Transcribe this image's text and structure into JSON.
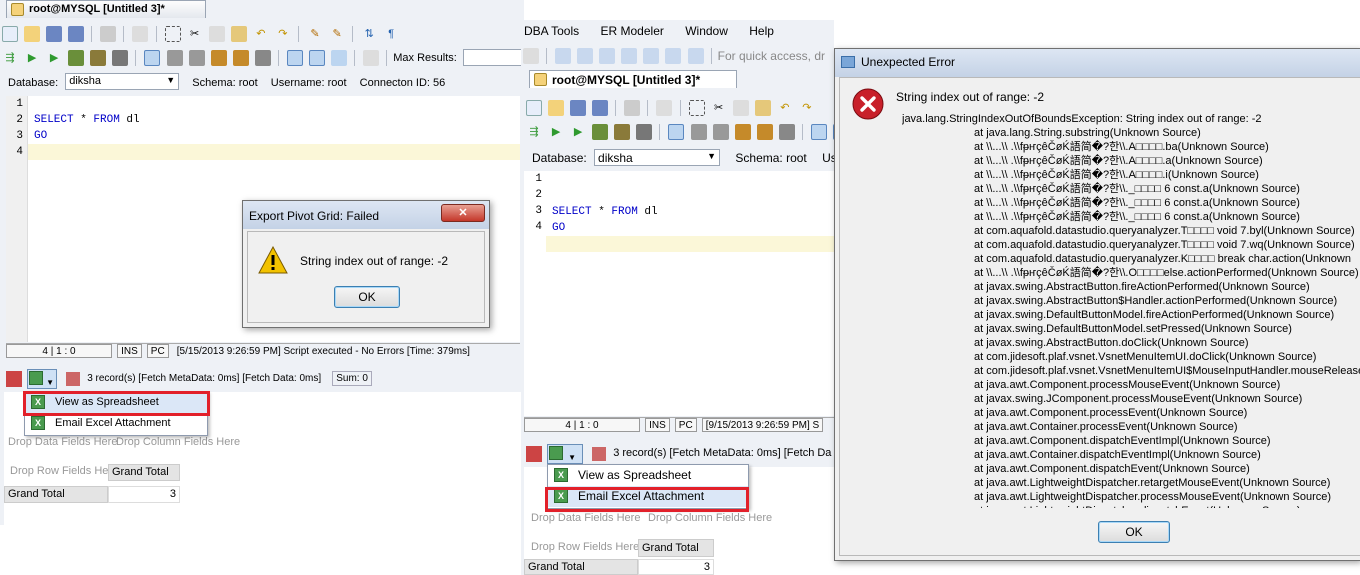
{
  "left_window": {
    "tab_title": "root@MYSQL [Untitled 3]*",
    "max_results_label": "Max Results:",
    "database_label": "Database:",
    "database_value": "diksha",
    "schema_text": "Schema:  root",
    "username_text": "Username:  root",
    "connection_text": "Connecton ID:  56",
    "line_numbers": [
      "1",
      "2",
      "3",
      "4"
    ],
    "code_kw_select": "SELECT",
    "code_star": " * ",
    "code_kw_from": "FROM",
    "code_table": " dl",
    "code_go": "GO",
    "status": {
      "pos": "4 | 1 : 0",
      "mode1": "INS",
      "mode2": "PC",
      "message": "[5/15/2013 9:26:59 PM] Script executed - No Errors [Time: 379ms]"
    },
    "results_bar": {
      "records": "3 record(s) [Fetch MetaData: 0ms] [Fetch Data: 0ms]",
      "sum": "Sum: 0"
    },
    "menu": {
      "item1": "View as Spreadsheet",
      "item2": "Email Excel Attachment"
    },
    "pivot": {
      "drop_data": "Drop Data Fields Here",
      "drop_column": "Drop Column Fields Here",
      "drop_row": "Drop Row Fields Here",
      "grand_total_header": "Grand Total",
      "grand_total_row": "Grand Total",
      "grand_total_value": "3"
    }
  },
  "export_dialog": {
    "title": "Export Pivot Grid: Failed",
    "message": "String index out of range: -2",
    "ok": "OK",
    "close": "✕"
  },
  "middle_window": {
    "menu_items": [
      "DBA Tools",
      "ER Modeler",
      "Window",
      "Help"
    ],
    "quick_access": "For quick access, dr",
    "tab_title": "root@MYSQL [Untitled 3]*",
    "database_label": "Database:",
    "database_value": "diksha",
    "schema_text": "Schema:  root",
    "user_text": "User",
    "line_numbers": [
      "1",
      "2",
      "3",
      "4"
    ],
    "code_kw_select": "SELECT",
    "code_star": " * ",
    "code_kw_from": "FROM",
    "code_table": " dl",
    "code_go": "GO",
    "status": {
      "pos": "4 | 1 : 0",
      "mode1": "INS",
      "mode2": "PC",
      "message": "[9/15/2013 9:26:59 PM] S"
    },
    "results_bar": {
      "records": "3 record(s) [Fetch MetaData: 0ms] [Fetch Da"
    },
    "menu": {
      "item1": "View as Spreadsheet",
      "item2": "Email Excel Attachment"
    },
    "pivot": {
      "drop_data": "Drop Data Fields Here",
      "drop_column": "Drop Column Fields Here",
      "drop_row": "Drop Row Fields Here",
      "grand_total_header": "Grand Total",
      "grand_total_row": "Grand Total",
      "grand_total_value": "3"
    }
  },
  "error_dialog": {
    "title": "Unexpected Error",
    "message": "String index out of range: -2",
    "exception": "java.lang.StringIndexOutOfBoundsException: String index out of range: -2",
    "ok": "OK",
    "trace": [
      "at java.lang.String.substring(Unknown Source)",
      "at \\\\...\\\\ .\\\\fᵽҥçêČøḰ語简�?한\\\\.A□□□□.ba(Unknown Source)",
      "at \\\\...\\\\ .\\\\fᵽҥçêČøḰ語简�?한\\\\.A□□□□.a(Unknown Source)",
      "at \\\\...\\\\ .\\\\fᵽҥçêČøḰ語简�?한\\\\.A□□□□.i(Unknown Source)",
      "at \\\\...\\\\ .\\\\fᵽҥçêČøḰ語简�?한\\\\._□□□□ 6 const.a(Unknown Source)",
      "at \\\\...\\\\ .\\\\fᵽҥçêČøḰ語简�?한\\\\._□□□□ 6 const.a(Unknown Source)",
      "at \\\\...\\\\ .\\\\fᵽҥçêČøḰ語简�?한\\\\._□□□□ 6 const.a(Unknown Source)",
      "at com.aquafold.datastudio.queryanalyzer.T□□□□ void 7.byl(Unknown Source)",
      "at com.aquafold.datastudio.queryanalyzer.T□□□□ void 7.wq(Unknown Source)",
      "at com.aquafold.datastudio.queryanalyzer.K□□□□ break char.action(Unknown",
      "at \\\\...\\\\ .\\\\fᵽҥçêČøḰ語简�?한\\\\.O□□□□else.actionPerformed(Unknown Source)",
      "at javax.swing.AbstractButton.fireActionPerformed(Unknown Source)",
      "at javax.swing.AbstractButton$Handler.actionPerformed(Unknown Source)",
      "at javax.swing.DefaultButtonModel.fireActionPerformed(Unknown Source)",
      "at javax.swing.DefaultButtonModel.setPressed(Unknown Source)",
      "at javax.swing.AbstractButton.doClick(Unknown Source)",
      "at com.jidesoft.plaf.vsnet.VsnetMenuItemUI.doClick(Unknown Source)",
      "at com.jidesoft.plaf.vsnet.VsnetMenuItemUI$MouseInputHandler.mouseRelease",
      "at java.awt.Component.processMouseEvent(Unknown Source)",
      "at javax.swing.JComponent.processMouseEvent(Unknown Source)",
      "at java.awt.Component.processEvent(Unknown Source)",
      "at java.awt.Container.processEvent(Unknown Source)",
      "at java.awt.Component.dispatchEventImpl(Unknown Source)",
      "at java.awt.Container.dispatchEventImpl(Unknown Source)",
      "at java.awt.Component.dispatchEvent(Unknown Source)",
      "at java.awt.LightweightDispatcher.retargetMouseEvent(Unknown Source)",
      "at java.awt.LightweightDispatcher.processMouseEvent(Unknown Source)",
      "at java.awt.LightweightDispatcher.dispatchEvent(Unknown Source)"
    ]
  },
  "colors": {
    "highlight_border": "#e2202a",
    "keyword": "#0000c8",
    "error_icon": "#c8202a",
    "warning_icon": "#f2c200"
  }
}
